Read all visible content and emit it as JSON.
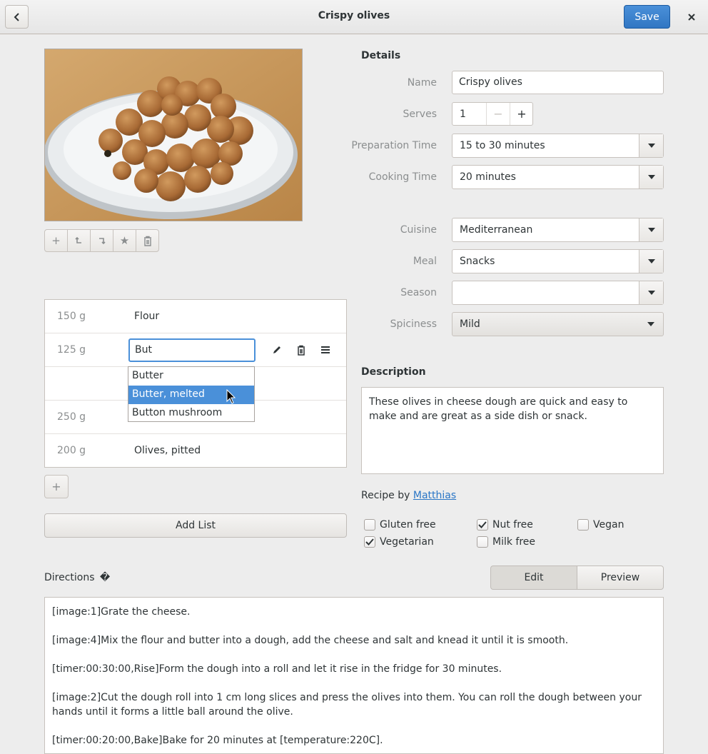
{
  "header": {
    "title": "Crispy olives",
    "save_label": "Save"
  },
  "photo_toolbar": {
    "icons": [
      "add-icon",
      "rotate-left-icon",
      "rotate-right-icon",
      "star-icon",
      "trash-icon"
    ]
  },
  "ingredients": {
    "rows": [
      {
        "amount": "150 g",
        "name": "Flour"
      },
      {
        "amount": "125 g",
        "name": "But"
      },
      {
        "amount": "",
        "name": ""
      },
      {
        "amount": "250 g",
        "name": ""
      },
      {
        "amount": "200 g",
        "name": "Olives, pitted"
      }
    ],
    "autocomplete": [
      "Butter",
      "Butter, melted",
      "Button mushroom"
    ],
    "add_list_label": "Add List"
  },
  "details": {
    "title": "Details",
    "name_label": "Name",
    "name_value": "Crispy olives",
    "serves_label": "Serves",
    "serves_value": "1",
    "prep_label": "Preparation Time",
    "prep_value": "15 to 30 minutes",
    "cook_label": "Cooking Time",
    "cook_value": "20 minutes",
    "cuisine_label": "Cuisine",
    "cuisine_value": "Mediterranean",
    "meal_label": "Meal",
    "meal_value": "Snacks",
    "season_label": "Season",
    "season_value": "",
    "spiciness_label": "Spiciness",
    "spiciness_value": "Mild"
  },
  "description": {
    "title": "Description",
    "text": "These olives in cheese dough are quick and easy to make and are great as a side dish or snack."
  },
  "recipe_by": {
    "prefix": "Recipe by",
    "author": "Matthias"
  },
  "diets": [
    {
      "label": "Gluten free",
      "checked": false
    },
    {
      "label": "Nut free",
      "checked": true
    },
    {
      "label": "Vegan",
      "checked": false
    },
    {
      "label": "Vegetarian",
      "checked": true
    },
    {
      "label": "Milk free",
      "checked": false
    }
  ],
  "directions": {
    "label": "Directions",
    "icon_glyph": "�",
    "edit_label": "Edit",
    "preview_label": "Preview",
    "steps": [
      "[image:1]Grate the cheese.",
      "[image:4]Mix the flour and butter into a dough, add the cheese and salt and knead it until it is smooth.",
      "[timer:00:30:00,Rise]Form the dough into a roll and let it rise in the fridge for 30 minutes.",
      "[image:2]Cut the dough roll into 1 cm long slices and press the olives into them. You can roll the dough between your hands until it forms a little ball around the olive.",
      "[timer:00:20:00,Bake]Bake for 20 minutes at [temperature:220C]."
    ]
  },
  "colors": {
    "accent": "#4a90d9",
    "link": "#2a76c6",
    "background": "#ededed"
  }
}
